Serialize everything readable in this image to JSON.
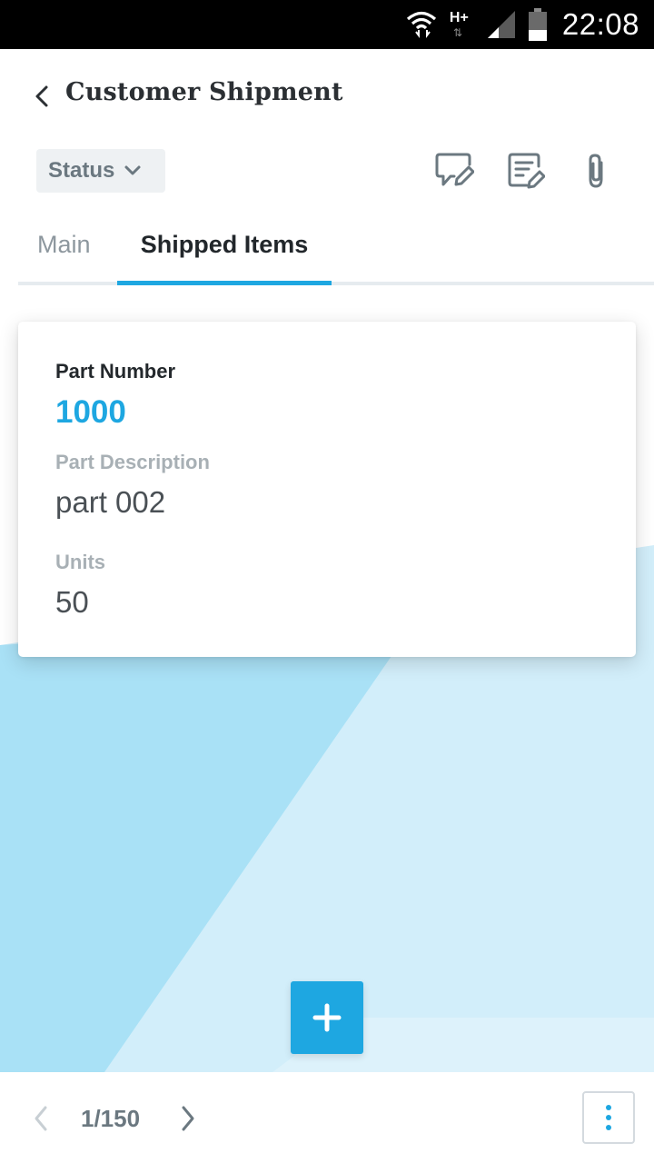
{
  "status_bar": {
    "network_type": "H+",
    "time": "22:08",
    "icons": [
      "wifi-icon",
      "network-type-icon",
      "signal-icon",
      "battery-icon"
    ]
  },
  "header": {
    "back_icon": "chevron-left-icon",
    "title": "Customer Shipment"
  },
  "toolbar": {
    "status_label": "Status",
    "status_icon": "chevron-down-icon",
    "actions": [
      {
        "name": "comment-edit-icon"
      },
      {
        "name": "note-edit-icon"
      },
      {
        "name": "paperclip-icon"
      }
    ]
  },
  "tabs": [
    {
      "label": "Main",
      "active": false
    },
    {
      "label": "Shipped Items",
      "active": true
    }
  ],
  "card": {
    "part_number_label": "Part Number",
    "part_number_value": "1000",
    "part_description_label": "Part Description",
    "part_description_value": "part 002",
    "units_label": "Units",
    "units_value": "50"
  },
  "fab": {
    "icon": "plus-icon"
  },
  "footer": {
    "prev_icon": "chevron-left-icon",
    "page_indicator": "1/150",
    "next_icon": "chevron-right-icon",
    "more_icon": "more-vertical-icon"
  },
  "colors": {
    "accent": "#1ea7e1",
    "title_text": "#2b2f33",
    "muted_text": "#6b7880",
    "label_text": "#a8b0b5",
    "chip_bg": "#eef1f3",
    "bg_light_blue": "#d2eefa",
    "bg_mid_blue": "#a9e1f6"
  }
}
